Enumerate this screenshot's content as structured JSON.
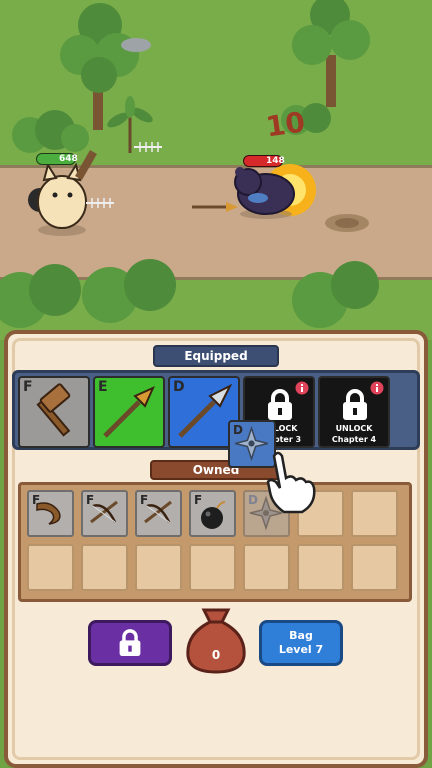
{
  "battle": {
    "player_hp": "648",
    "enemy_hp": "148",
    "damage_number": "10"
  },
  "equipped": {
    "title": "Equipped",
    "slots": [
      {
        "grade": "F",
        "item": "hammer-icon",
        "color": "#9c9a98"
      },
      {
        "grade": "E",
        "item": "spear-icon",
        "color": "#3fbf2e"
      },
      {
        "grade": "D",
        "item": "spear-icon",
        "color": "#2f6fd9"
      },
      {
        "locked": true,
        "line1": "UNLOCK",
        "line2": "Chapter 3"
      },
      {
        "locked": true,
        "line1": "UNLOCK",
        "line2": "Chapter 4"
      }
    ],
    "dragging_grade": "D"
  },
  "owned": {
    "title": "Owned",
    "items": [
      {
        "grade": "F",
        "item": "boomerang-icon"
      },
      {
        "grade": "F",
        "item": "crossbow-icon"
      },
      {
        "grade": "F",
        "item": "crossbow-icon"
      },
      {
        "grade": "F",
        "item": "bomb-icon"
      },
      {
        "grade": "D",
        "item": "shuriken-icon"
      }
    ]
  },
  "bottom": {
    "bag_count": "0",
    "bag_button_line1": "Bag",
    "bag_button_line2": "Level 7"
  },
  "colors": {
    "panel_bg": "#f7ead7",
    "panel_border": "#8a5b3a",
    "equip_bg": "#4a5f86",
    "purple_btn": "#6a2fa3",
    "blue_btn": "#2f7ed8"
  }
}
